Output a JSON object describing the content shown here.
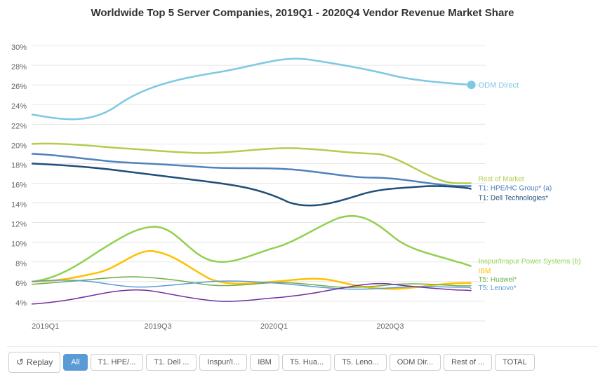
{
  "title": "Worldwide Top 5 Server Companies, 2019Q1 - 2020Q4 Vendor Revenue Market Share",
  "xLabels": [
    "2019Q1",
    "2019Q3",
    "2020Q1",
    "2020Q3"
  ],
  "yLabels": [
    "30%",
    "28%",
    "26%",
    "24%",
    "22%",
    "20%",
    "18%",
    "16%",
    "14%",
    "12%",
    "10%",
    "8%",
    "6%",
    "4%"
  ],
  "legend": {
    "odmDirect": "ODM Direct",
    "restOfMarket": "Rest of Market",
    "hpeHPEGroup": "T1: HPE/HC Group* (a)",
    "dellTech": "T1: Dell Technologies*",
    "inspur": "Inspur/Inspur Power Systems (b)",
    "ibm": "IBM",
    "huawei": "T5: Huawei*",
    "lenovo": "T5: Lenovo*"
  },
  "bottomBar": {
    "replay": "Replay",
    "all": "All",
    "hpe": "T1. HPE/...",
    "dell": "T1. Dell ...",
    "inspur": "Inspur/I...",
    "ibm": "IBM",
    "huawei": "T5. Hua...",
    "lenovo": "T5. Leno...",
    "odm": "ODM Dir...",
    "rest": "Rest of ...",
    "total": "TOTAL"
  },
  "colors": {
    "odmDirect": "#7ec8e3",
    "restOfMarket": "#b5cc4f",
    "hpe": "#4f81bd",
    "dell": "#1f4e79",
    "inspur": "#92d050",
    "ibm": "#ffc000",
    "huawei": "#70ad47",
    "lenovo": "#5b9bd5",
    "purple": "#7030a0"
  }
}
